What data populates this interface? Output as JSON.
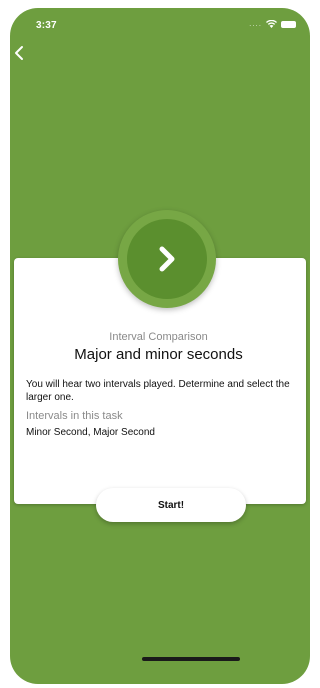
{
  "status_bar": {
    "time": "3:37",
    "signal": "....",
    "wifi_icon": "wifi-icon",
    "battery_icon": "battery-icon"
  },
  "nav": {
    "back_icon": "chevron-left-icon"
  },
  "card": {
    "go_icon": "chevron-right-icon",
    "subtitle": "Interval Comparison",
    "title": "Major and minor seconds",
    "description": "You will hear two intervals played. Determine and select the larger one.",
    "intervals_label": "Intervals in this task",
    "intervals_value": "Minor Second, Major Second",
    "start_label": "Start!"
  },
  "colors": {
    "background_green": "#6e9e3f",
    "circle_outer": "#77a745",
    "circle_inner": "#5b8f2e",
    "card": "#ffffff"
  }
}
